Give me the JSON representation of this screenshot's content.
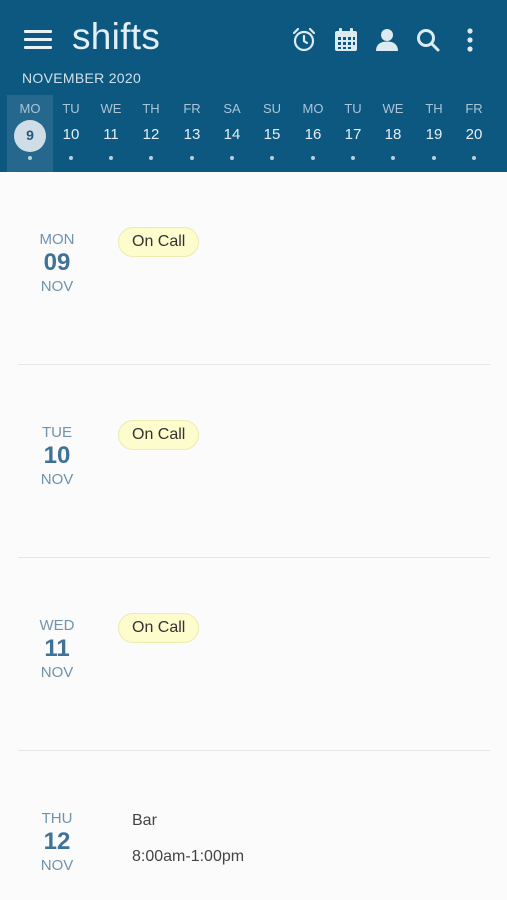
{
  "app": {
    "title": "shifts",
    "month_label": "NOVEMBER 2020"
  },
  "toolbar_icons": [
    "alarm-icon",
    "calendar-icon",
    "user-icon",
    "search-icon",
    "more-vert-icon"
  ],
  "colors": {
    "header_bg": "#0d5880",
    "selected_day_bg": "#26688d",
    "badge_bg": "#fdfccc",
    "date_text": "#3f7396"
  },
  "week_strip": [
    {
      "dow": "MO",
      "num": "9",
      "selected": true
    },
    {
      "dow": "TU",
      "num": "10"
    },
    {
      "dow": "WE",
      "num": "11"
    },
    {
      "dow": "TH",
      "num": "12"
    },
    {
      "dow": "FR",
      "num": "13"
    },
    {
      "dow": "SA",
      "num": "14"
    },
    {
      "dow": "SU",
      "num": "15"
    },
    {
      "dow": "MO",
      "num": "16"
    },
    {
      "dow": "TU",
      "num": "17"
    },
    {
      "dow": "WE",
      "num": "18"
    },
    {
      "dow": "TH",
      "num": "19"
    },
    {
      "dow": "FR",
      "num": "20"
    }
  ],
  "days": [
    {
      "dow": "MON",
      "num": "09",
      "mon": "NOV",
      "badge": "On Call"
    },
    {
      "dow": "TUE",
      "num": "10",
      "mon": "NOV",
      "badge": "On Call"
    },
    {
      "dow": "WED",
      "num": "11",
      "mon": "NOV",
      "badge": "On Call"
    },
    {
      "dow": "THU",
      "num": "12",
      "mon": "NOV",
      "shift_name": "Bar",
      "shift_time": "8:00am-1:00pm"
    }
  ]
}
